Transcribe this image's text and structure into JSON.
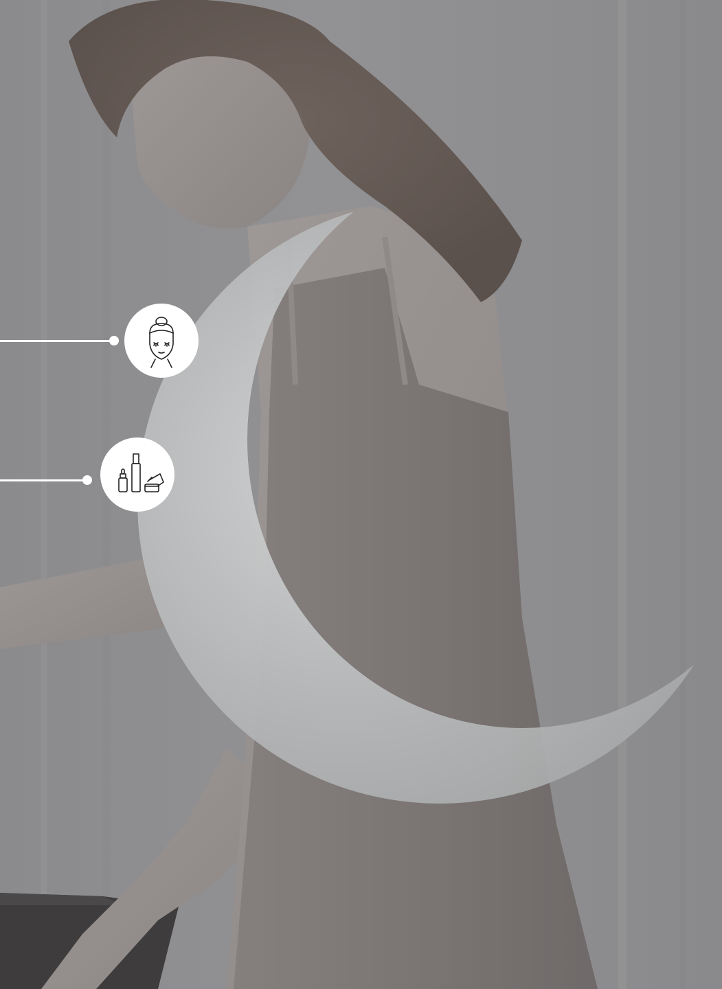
{
  "hotspots": [
    {
      "name": "facial-treatment",
      "icon": "face-mask-icon"
    },
    {
      "name": "skincare-products",
      "icon": "skincare-bottles-icon"
    }
  ],
  "colors": {
    "overlay": "#8c8c8e",
    "crescent": "#a4a6a7",
    "hotspot": "#ffffff",
    "icon_stroke": "#222222"
  }
}
